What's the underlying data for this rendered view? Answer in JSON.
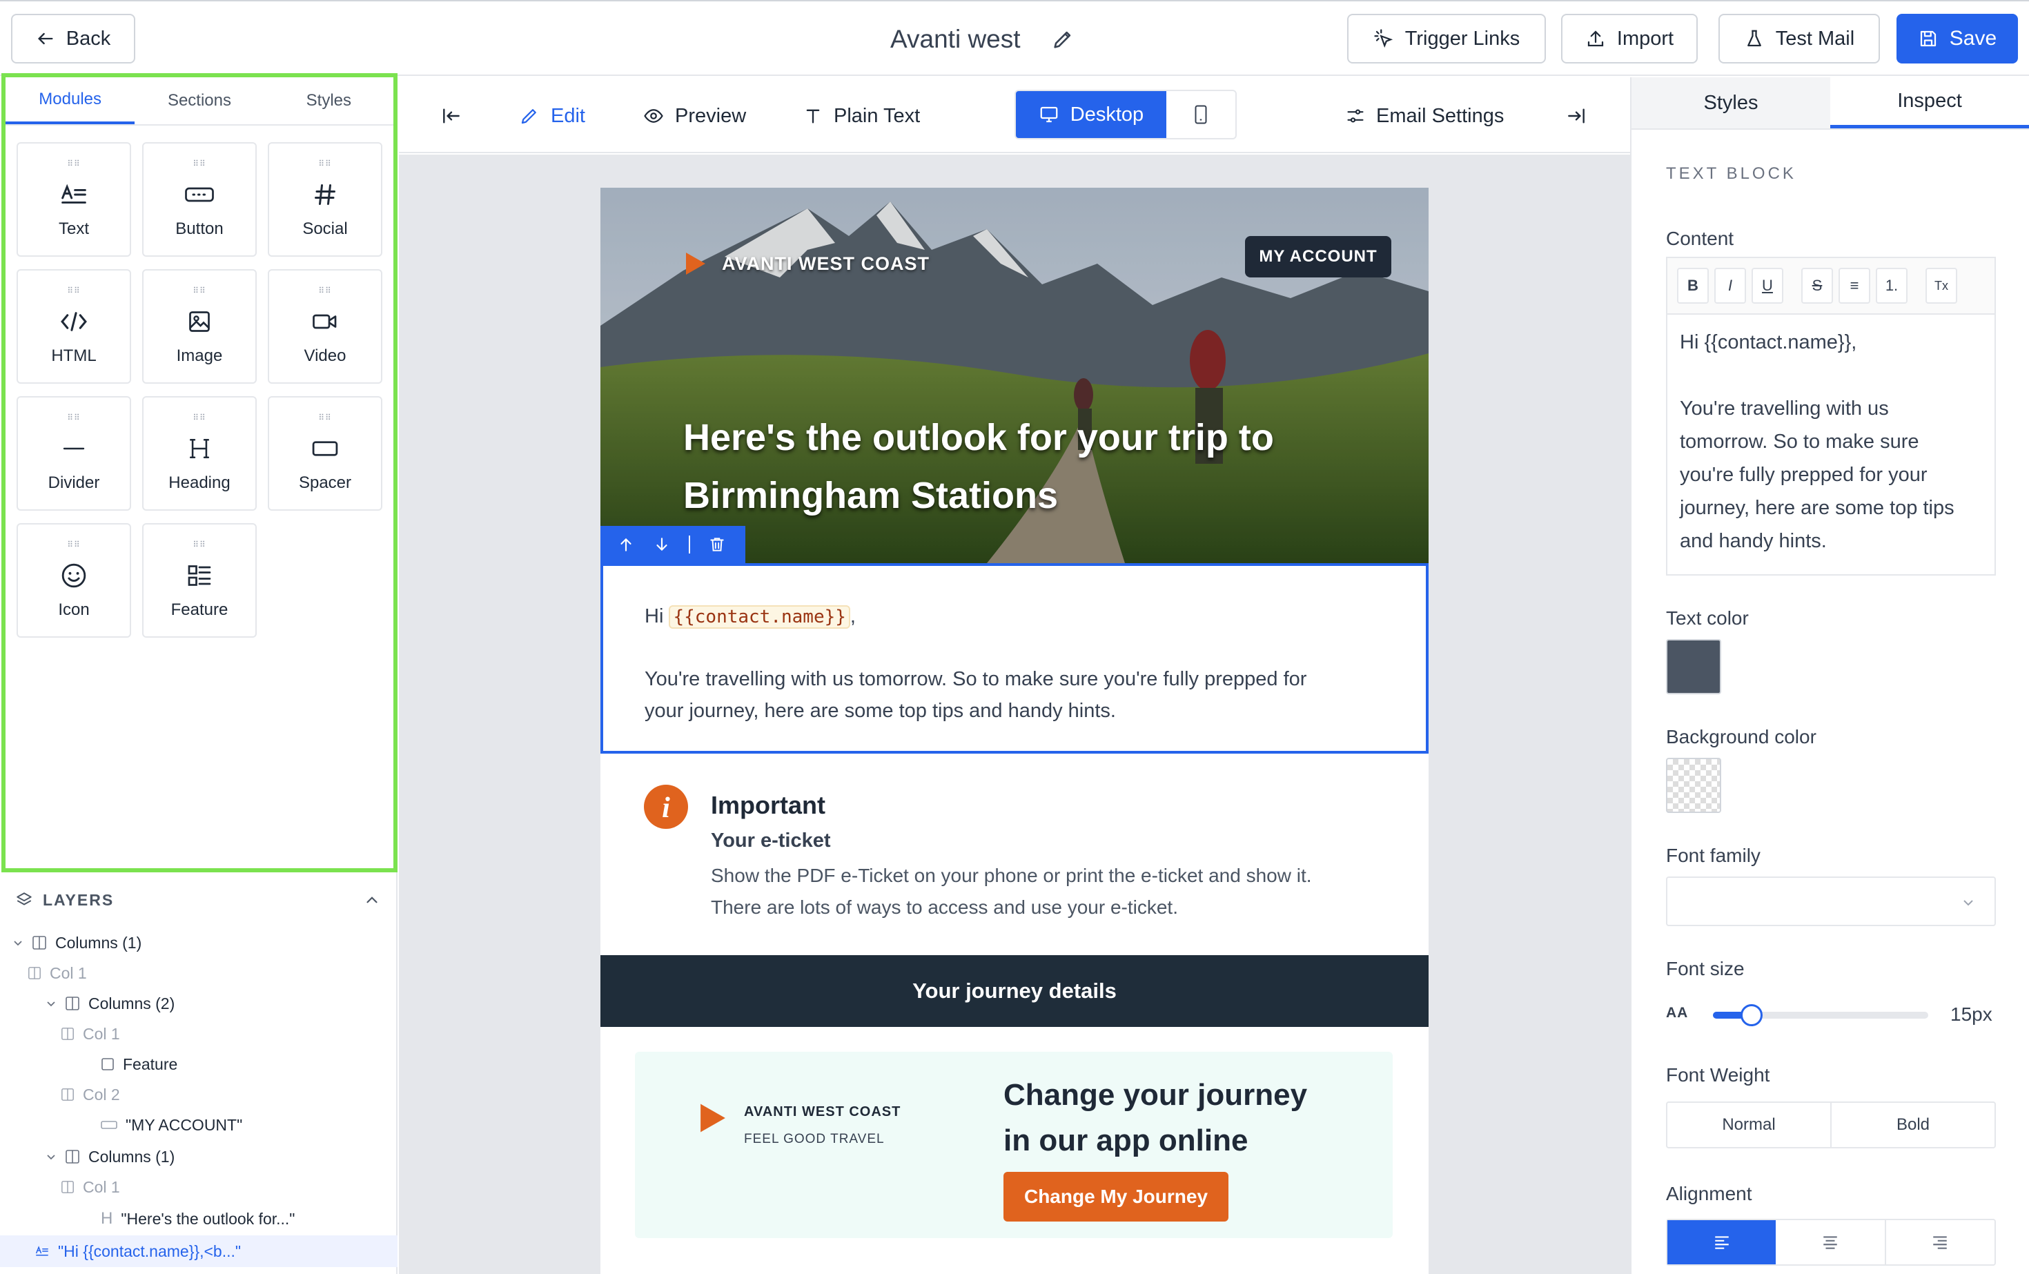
{
  "colors": {
    "accent": "#2563eb",
    "highlight": "#7be24f",
    "cta": "#e0631e",
    "text_color_swatch": "#4b5563",
    "dark_bar": "#1f2d3a"
  },
  "topbar": {
    "back_label": "Back",
    "doc_title": "Avanti west",
    "trigger_links_label": "Trigger Links",
    "import_label": "Import",
    "test_mail_label": "Test Mail",
    "save_label": "Save"
  },
  "left_panel": {
    "tabs": [
      "Modules",
      "Sections",
      "Styles"
    ],
    "modules": [
      "Text",
      "Button",
      "Social",
      "HTML",
      "Image",
      "Video",
      "Divider",
      "Heading",
      "Spacer",
      "Icon",
      "Feature"
    ],
    "layers_title": "LAYERS",
    "layers": [
      "Columns (1)",
      "Col 1",
      "Columns (2)",
      "Col 1",
      "Feature",
      "Col 2",
      "\"MY ACCOUNT\"",
      "Columns (1)",
      "Col 1",
      "\"Here's the outlook for...\"",
      "\"Hi {{contact.name}},<b...\""
    ]
  },
  "toolbar": {
    "edit_label": "Edit",
    "preview_label": "Preview",
    "plain_text_label": "Plain Text",
    "desktop_label": "Desktop",
    "email_settings_label": "Email Settings"
  },
  "email": {
    "brand": "AVANTI WEST COAST",
    "my_account": "MY ACCOUNT",
    "hero_line1": "Here's the outlook for your trip to",
    "hero_line2": "Birmingham Stations",
    "greeting_prefix": "Hi",
    "greeting_token": "{{contact.name}}",
    "greeting_suffix": ",",
    "body_line1": "You're travelling with us tomorrow. So to make sure you're fully prepped for",
    "body_line2": "your journey, here are some top tips and handy hints.",
    "important_title": "Important",
    "important_sub": "Your e-ticket",
    "important_line1": "Show the PDF e-Ticket on your phone or print the e-ticket and show it.",
    "important_line2": "There are lots of ways to access and use your e-ticket.",
    "journey_bar": "Your journey details",
    "app_brand": "AVANTI WEST COAST",
    "app_tagline": "FEEL GOOD TRAVEL",
    "app_heading_line1": "Change your journey",
    "app_heading_line2": "in our app online",
    "cta_label": "Change My Journey"
  },
  "right_panel": {
    "tabs": [
      "Styles",
      "Inspect"
    ],
    "section_title": "TEXT BLOCK",
    "content_label": "Content",
    "fmt_buttons": [
      "B",
      "I",
      "U",
      "S",
      "≡",
      "1.",
      "Tx"
    ],
    "content_lines": [
      "Hi {{contact.name}},",
      "",
      "You're travelling with us",
      "tomorrow. So to make sure",
      "you're fully prepped for your",
      "journey, here are some top tips",
      "and handy hints."
    ],
    "text_color_label": "Text color",
    "bg_color_label": "Background color",
    "font_family_label": "Font family",
    "font_size_label": "Font size",
    "font_size_icon": "AA",
    "font_size_value": "15px",
    "font_size_fraction": 0.18,
    "font_weight_label": "Font Weight",
    "weights": [
      "Normal",
      "Bold"
    ],
    "alignment_label": "Alignment"
  }
}
